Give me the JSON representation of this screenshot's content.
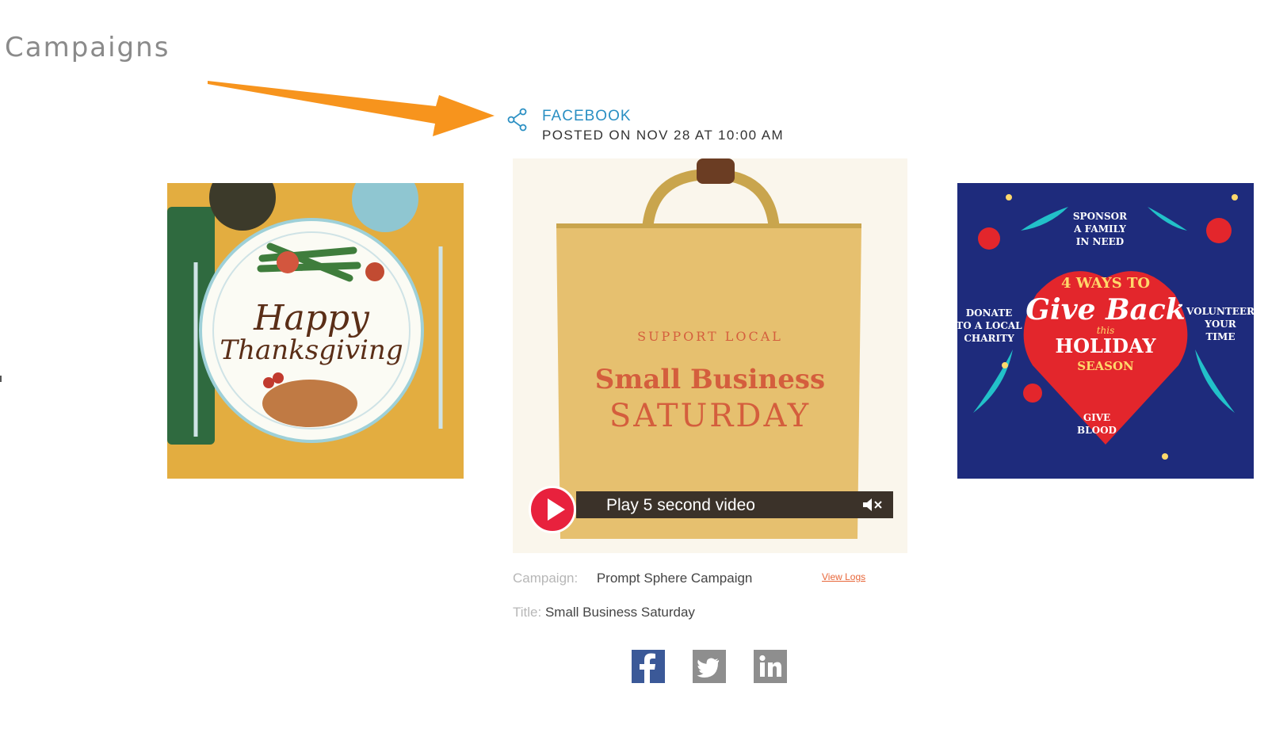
{
  "page": {
    "title": "Campaigns"
  },
  "post": {
    "network_label": "FACEBOOK",
    "posted_on": "POSTED ON NOV 28 AT 10:00 AM",
    "image_text": {
      "top_arc": "SUPPORT LOCAL",
      "line1": "Small Business",
      "line2": "SATURDAY"
    },
    "video_label": "Play 5 second video",
    "campaign_key": "Campaign:",
    "campaign_value": "Prompt Sphere Campaign",
    "title_key": "Title:",
    "title_value": "Small Business Saturday",
    "view_logs_label": "View Logs"
  },
  "left_card": {
    "line1": "Happy",
    "line2": "Thanksgiving"
  },
  "right_card": {
    "heading1": "4 WAYS TO",
    "heading2": "Give Back",
    "heading3": "this",
    "heading4": "HOLIDAY",
    "heading5": "SEASON",
    "item_top": [
      "SPONSOR",
      "A FAMILY",
      "IN NEED"
    ],
    "item_left": [
      "DONATE",
      "TO A LOCAL",
      "CHARITY"
    ],
    "item_right": [
      "VOLUNTEER",
      "YOUR",
      "TIME"
    ],
    "item_bottom": [
      "GIVE",
      "BLOOD"
    ]
  },
  "share_buttons": [
    {
      "icon": "facebook-icon",
      "color": "#3b5998"
    },
    {
      "icon": "twitter-icon",
      "color": "#8e8e8e"
    },
    {
      "icon": "linkedin-icon",
      "color": "#8e8e8e"
    }
  ],
  "colors": {
    "accent": "#2a8fc3",
    "arrow": "#f7941d",
    "play": "#e8213d",
    "link": "#e8673a"
  }
}
